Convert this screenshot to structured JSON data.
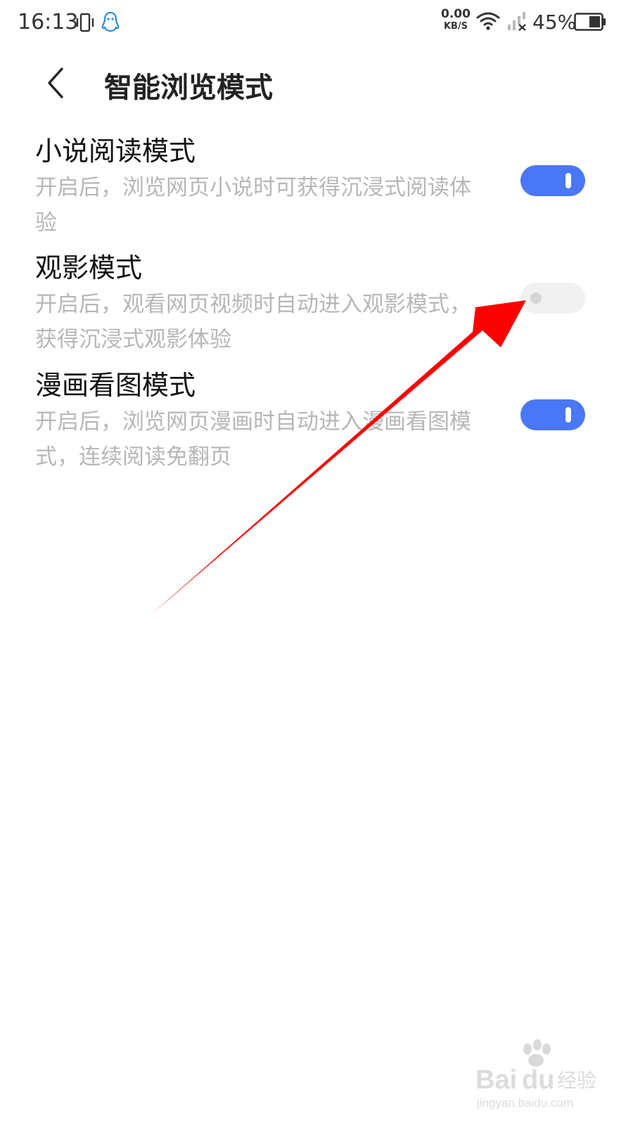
{
  "status_bar": {
    "time": "16:13",
    "net_speed_value": "0.00",
    "net_speed_unit": "KB/S",
    "battery": "45%",
    "icons": [
      "vibrate-icon",
      "qq-icon",
      "wifi-icon",
      "signal-icon",
      "battery-icon"
    ]
  },
  "header": {
    "back_icon": "chevron-left-icon",
    "title": "智能浏览模式"
  },
  "settings": [
    {
      "title": "小说阅读模式",
      "description": "开启后，浏览网页小说时可获得沉浸式阅读体验",
      "enabled": true
    },
    {
      "title": "观影模式",
      "description": "开启后，观看网页视频时自动进入观影模式，获得沉浸式观影体验",
      "enabled": false
    },
    {
      "title": "漫画看图模式",
      "description": "开启后，浏览网页漫画时自动进入漫画看图模式，连续阅读免翻页",
      "enabled": true
    }
  ],
  "colors": {
    "toggle_on": "#4a77f6",
    "toggle_off": "#f1f1f1",
    "description_text": "#b7b7b7",
    "annotation_arrow": "#ff0000"
  },
  "watermark": {
    "brand": "Baidu经验",
    "url": "jingyan.baidu.com"
  }
}
